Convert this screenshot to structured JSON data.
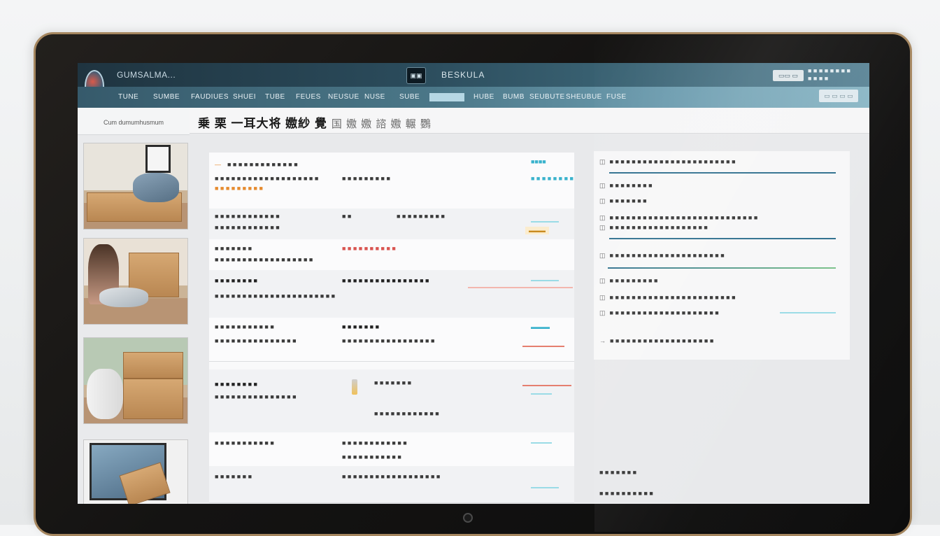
{
  "app": {
    "title": "GUMSALMA...",
    "center_badge": "▣▣",
    "center_title": "BESKULA",
    "top_button": "▭▭ ▭",
    "top_status": [
      "■ ■ ■ ■ ■ ■ ■ ■",
      "■ ■ ■ ■"
    ]
  },
  "nav": {
    "items": [
      "TUNE",
      "SUMBE",
      "FAUDIUES",
      "SHUEI",
      "TUBE",
      "FEUES",
      "NEUSUE",
      "NUSE",
      "SUBE",
      "",
      "HUBE",
      "BUMB",
      "SEUBUTE",
      "SHEUBUE",
      "FUSE"
    ],
    "search": "▭ ▭ ▭ ▭"
  },
  "sidebar": {
    "header": "Cum dumumhusmum"
  },
  "heading": {
    "title": "乗 栗 一耳大将 嫐紗 覺",
    "subtitle": "国 嫐 嫐 諮 嫐 輾 鸚"
  },
  "table": {
    "rows": [
      {
        "c1": "—",
        "c2": "■ ■ ■ ■ ■ ■ ■ ■ ■ ■ ■ ■ ■",
        "c3": "■■■■",
        "c4": "■ ■ ■ ■ ■ ■ ■ ■ ■ ■ ■ ■ ■ ■ ■ ■ ■ ■ ■",
        "c5": "■ ■ ■ ■ ■ ■ ■ ■ ■",
        "c6": "■ ■ ■ ■ ■ ■ ■ ■ ■",
        "c7": "■ ■ ■ ■ ■ ■ ■ ■"
      },
      {
        "c1": "■ ■ ■ ■ ■ ■ ■ ■ ■ ■ ■ ■",
        "c2": "■ ■ ■ ■ ■ ■ ■ ■ ■ ■ ■ ■",
        "c3": "■ ■",
        "c4": "■ ■ ■ ■ ■ ■ ■ ■ ■"
      },
      {
        "c1": "■ ■ ■ ■ ■ ■ ■",
        "c2": "■ ■ ■ ■ ■ ■ ■ ■ ■ ■",
        "c3": "■ ■ ■ ■ ■ ■ ■ ■ ■ ■ ■ ■ ■ ■ ■ ■ ■ ■"
      },
      {
        "c1": "■ ■ ■ ■ ■ ■ ■ ■",
        "c2": "■ ■ ■ ■ ■ ■ ■ ■ ■ ■ ■ ■ ■ ■ ■ ■",
        "c3": "■ ■ ■ ■ ■ ■ ■ ■ ■ ■ ■ ■ ■ ■ ■ ■ ■ ■ ■ ■ ■ ■"
      },
      {
        "c1": "■ ■ ■ ■ ■ ■ ■ ■ ■ ■ ■",
        "c2": "■ ■ ■ ■ ■ ■ ■",
        "c3": "■ ■ ■ ■ ■ ■ ■ ■ ■ ■ ■ ■ ■ ■ ■",
        "c4": "■ ■ ■ ■ ■ ■ ■ ■ ■ ■ ■ ■ ■ ■ ■ ■ ■"
      },
      {
        "c1": "■ ■ ■ ■ ■ ■ ■ ■",
        "c2": "■ ■ ■ ■ ■ ■ ■",
        "c3": "■ ■ ■ ■ ■ ■ ■ ■ ■ ■ ■ ■ ■ ■ ■",
        "c4": "■ ■ ■ ■ ■ ■ ■ ■ ■ ■ ■ ■"
      },
      {
        "c1": "■ ■ ■ ■ ■ ■ ■ ■ ■ ■ ■",
        "c2": "■ ■ ■ ■ ■ ■ ■ ■ ■ ■ ■ ■",
        "c3": "■ ■ ■ ■ ■ ■ ■ ■ ■ ■ ■"
      },
      {
        "c1": "■ ■ ■ ■ ■ ■ ■",
        "c2": "■ ■ ■ ■ ■ ■ ■ ■ ■ ■ ■ ■ ■ ■ ■ ■ ■ ■"
      }
    ]
  },
  "details": {
    "lines": [
      "■ ■ ■ ■ ■ ■ ■ ■ ■ ■ ■ ■ ■ ■ ■ ■ ■ ■ ■ ■ ■ ■ ■",
      "■ ■ ■ ■ ■ ■ ■ ■",
      "■ ■ ■ ■ ■ ■ ■",
      "■ ■ ■ ■ ■ ■ ■ ■ ■ ■ ■ ■ ■ ■ ■ ■ ■ ■ ■ ■ ■ ■ ■ ■ ■ ■ ■",
      "■ ■ ■ ■ ■ ■ ■ ■ ■ ■ ■ ■ ■ ■ ■ ■ ■ ■",
      "■ ■ ■ ■ ■ ■ ■ ■ ■ ■ ■ ■ ■ ■ ■ ■ ■ ■ ■ ■ ■",
      "■ ■ ■ ■ ■ ■ ■ ■ ■",
      "■ ■ ■ ■ ■ ■ ■ ■ ■ ■ ■ ■ ■ ■ ■ ■ ■ ■ ■ ■ ■ ■ ■",
      "■ ■ ■ ■ ■ ■ ■ ■ ■ ■ ■ ■ ■ ■ ■ ■ ■ ■ ■ ■",
      "■ ■ ■ ■ ■ ■ ■ ■ ■ ■ ■ ■ ■ ■ ■ ■ ■ ■ ■"
    ],
    "bottom": [
      "■ ■ ■ ■ ■ ■ ■",
      "■ ■ ■ ■ ■ ■ ■ ■ ■ ■"
    ]
  },
  "colors": {
    "accent": "#39b2cc",
    "header_dark": "#1f3440",
    "nav": "#4b7788",
    "warning": "#e68a2e",
    "danger": "#d9534f"
  }
}
